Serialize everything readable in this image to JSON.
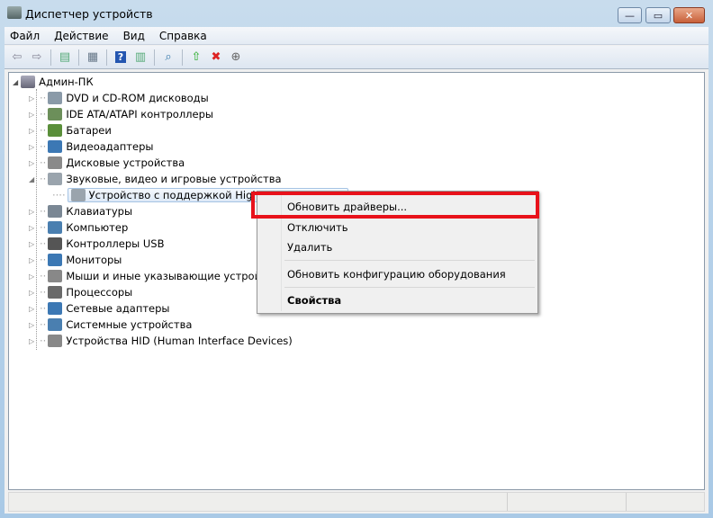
{
  "window": {
    "title": "Диспетчер устройств",
    "minimize": "—",
    "maximize": "▭",
    "close": "✕"
  },
  "menu": [
    "Файл",
    "Действие",
    "Вид",
    "Справка"
  ],
  "toolbar": [
    "back-icon",
    "forward-icon",
    "show-hide-console-tree-icon",
    "properties-icon",
    "help-icon",
    "action-pane-icon",
    "scan-hardware-icon",
    "update-driver-icon",
    "disable-device-icon",
    "uninstall-device-icon"
  ],
  "tree": {
    "root": "Админ-ПК",
    "items": [
      {
        "label": "DVD и CD-ROM дисководы",
        "icon_color": "#8a9aa8"
      },
      {
        "label": "IDE ATA/ATAPI контроллеры",
        "icon_color": "#6c8f5a"
      },
      {
        "label": "Батареи",
        "icon_color": "#5a8f3a"
      },
      {
        "label": "Видеоадаптеры",
        "icon_color": "#3c78b4"
      },
      {
        "label": "Дисковые устройства",
        "icon_color": "#8a8a8a"
      },
      {
        "label": "Звуковые, видео и игровые устройства",
        "icon_color": "#9aa4ad",
        "expanded": true,
        "children": [
          "Устройство с поддержкой High Definition Audio"
        ]
      },
      {
        "label": "Клавиатуры",
        "icon_color": "#7a8794"
      },
      {
        "label": "Компьютер",
        "icon_color": "#4a7fb0"
      },
      {
        "label": "Контроллеры USB",
        "icon_color": "#555"
      },
      {
        "label": "Мониторы",
        "icon_color": "#3c78b4"
      },
      {
        "label": "Мыши и иные указывающие устройства",
        "icon_color": "#888"
      },
      {
        "label": "Процессоры",
        "icon_color": "#6a6a6a"
      },
      {
        "label": "Сетевые адаптеры",
        "icon_color": "#3c78b4"
      },
      {
        "label": "Системные устройства",
        "icon_color": "#4a7fb0"
      },
      {
        "label": "Устройства HID (Human Interface Devices)",
        "icon_color": "#888"
      }
    ]
  },
  "context_menu": {
    "items": [
      "Обновить драйверы...",
      "Отключить",
      "Удалить",
      "Обновить конфигурацию оборудования",
      "Свойства"
    ]
  },
  "highlight_color": "#e8121b"
}
